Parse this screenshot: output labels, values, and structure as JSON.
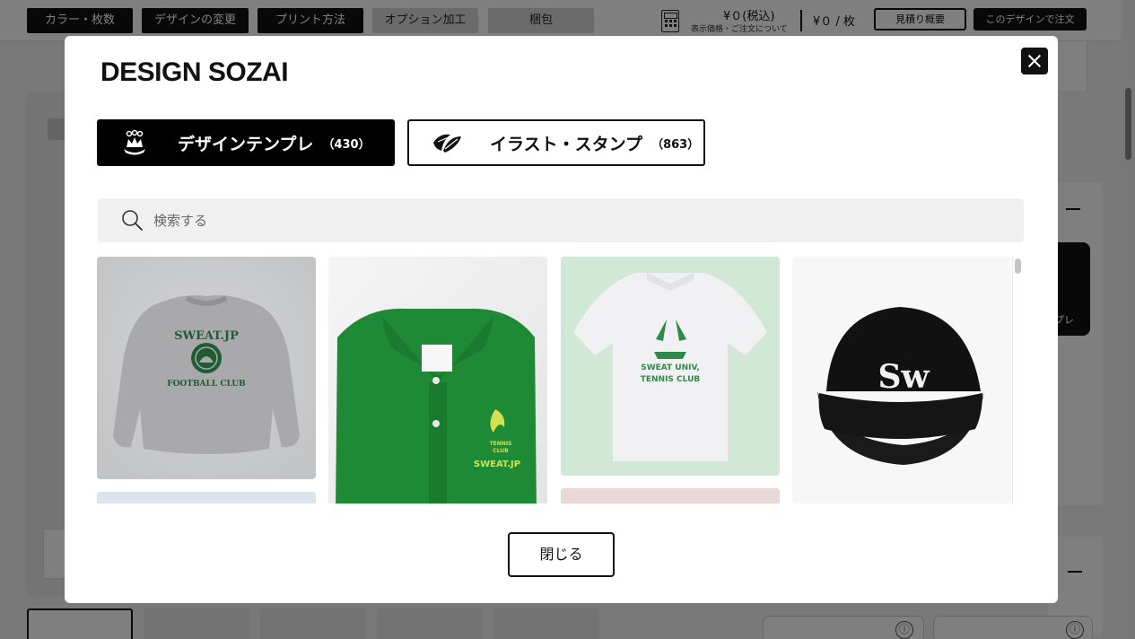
{
  "header": {
    "steps": [
      "カラー・枚数",
      "デザインの変更",
      "プリント方法",
      "オプション加工",
      "梱包"
    ],
    "price_label": "¥０(税込)",
    "price_note": "表示価格・ご注文について",
    "per_unit": "¥０ / 枚",
    "estimate_button": "見積り概要",
    "order_button": "このデザインで注文"
  },
  "side_panel": {
    "tab_fragment": "プレ"
  },
  "info_icon": "ⓘ",
  "modal": {
    "title": "DESIGN SOZAI",
    "tabs": [
      {
        "label": "デザインテンプレ",
        "count": "（430）",
        "icon": "crown-logo-icon",
        "active": true
      },
      {
        "label": "イラスト・スタンプ",
        "count": "（863）",
        "icon": "leaf-stamp-icon",
        "active": false
      }
    ],
    "search": {
      "placeholder": "検索する"
    },
    "items": [
      {
        "product": "sweatshirt",
        "color": "#a9a9ab",
        "print": "SWEAT.JP FOOTBALL CLUB",
        "line1": "SWEAT.JP",
        "line2": "FOOTBALL CLUB"
      },
      {
        "product": "polo-shirt",
        "color": "#1e8a35",
        "print": "TENNIS CLUB SWEAT.JP",
        "line1": "TENNIS",
        "line2": "CLUB",
        "line3": "SWEAT.JP"
      },
      {
        "product": "dry-polo",
        "color": "#f1f1f3",
        "print": "SWEAT UNIV, TENNIS CLUB",
        "line1": "SWEAT UNIV,",
        "line2": "TENNIS CLUB"
      },
      {
        "product": "cap",
        "color": "#111111",
        "print": "Sw",
        "line1": "Sw"
      }
    ],
    "close_label": "閉じる"
  }
}
